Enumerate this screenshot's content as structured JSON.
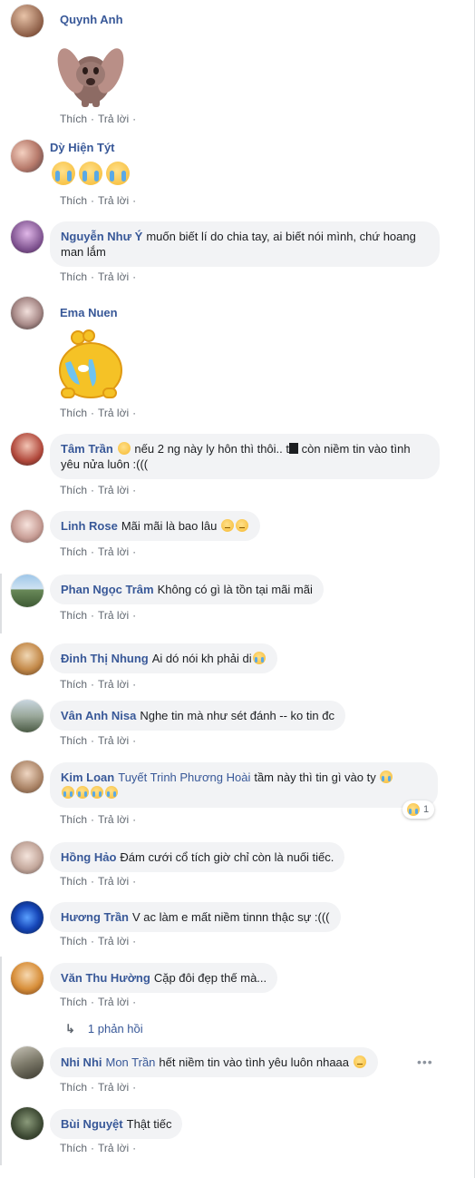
{
  "actions": {
    "like": "Thích",
    "reply": "Trả lời",
    "sep": "·"
  },
  "comments": [
    {
      "name": "Quynh Anh",
      "text": "",
      "sticker": "crying-dog-sticker"
    },
    {
      "name": "Dỳ Hiện Týt",
      "text": "",
      "emojis": [
        "loudly-crying-face-emoji",
        "loudly-crying-face-emoji",
        "loudly-crying-face-emoji"
      ]
    },
    {
      "name": "Nguyễn Như Ý",
      "text": "muốn biết lí do chia tay, ai biết nói mình, chứ hoang man lắm"
    },
    {
      "name": "Ema Nuen",
      "text": "",
      "sticker": "crying-bird-sticker"
    },
    {
      "name": "Tâm Trần",
      "text_a": "nếu 2 ng này ly hôn thì thôi.. t",
      "text_b": "còn niềm tin vào tình yêu nửa luôn :((("
    },
    {
      "name": "Linh Rose",
      "text": "Mãi mãi là bao lâu"
    },
    {
      "name": "Phan Ngọc Trâm",
      "text": "Không có gì là tồn tại mãi mãi"
    },
    {
      "name": "Đinh Thị Nhung",
      "text": "Ai dó nói kh phải di"
    },
    {
      "name": "Vân Anh Nisa",
      "text": "Nghe tin mà như sét đánh -- ko tin đc"
    },
    {
      "name": "Kim Loan",
      "mention": "Tuyết Trinh Phương Hoài",
      "text": "tầm này thì tin gì vào ty"
    },
    {
      "name": "Hồng Hảo",
      "text": "Đám cưới cổ tích giờ chỉ còn là nuối tiếc."
    },
    {
      "name": "Hương Trần",
      "text": "V ac làm e mất niềm tinnn thậc sự :((("
    },
    {
      "name": "Văn Thu Hường",
      "text": "Cặp đôi đẹp thế mà..."
    },
    {
      "name": "Nhi Nhi",
      "mention": "Mon Trần",
      "text": "hết niềm tin vào tình yêu luôn nhaaa"
    },
    {
      "name": "Bùi Nguyệt",
      "text": "Thật tiếc"
    }
  ],
  "reaction": {
    "count": "1",
    "icon": "sad-face-emoji"
  },
  "replies_link": "1 phản hồi",
  "colors": {
    "name": "#385898",
    "bubble": "#f2f3f5",
    "meta": "#606770"
  }
}
